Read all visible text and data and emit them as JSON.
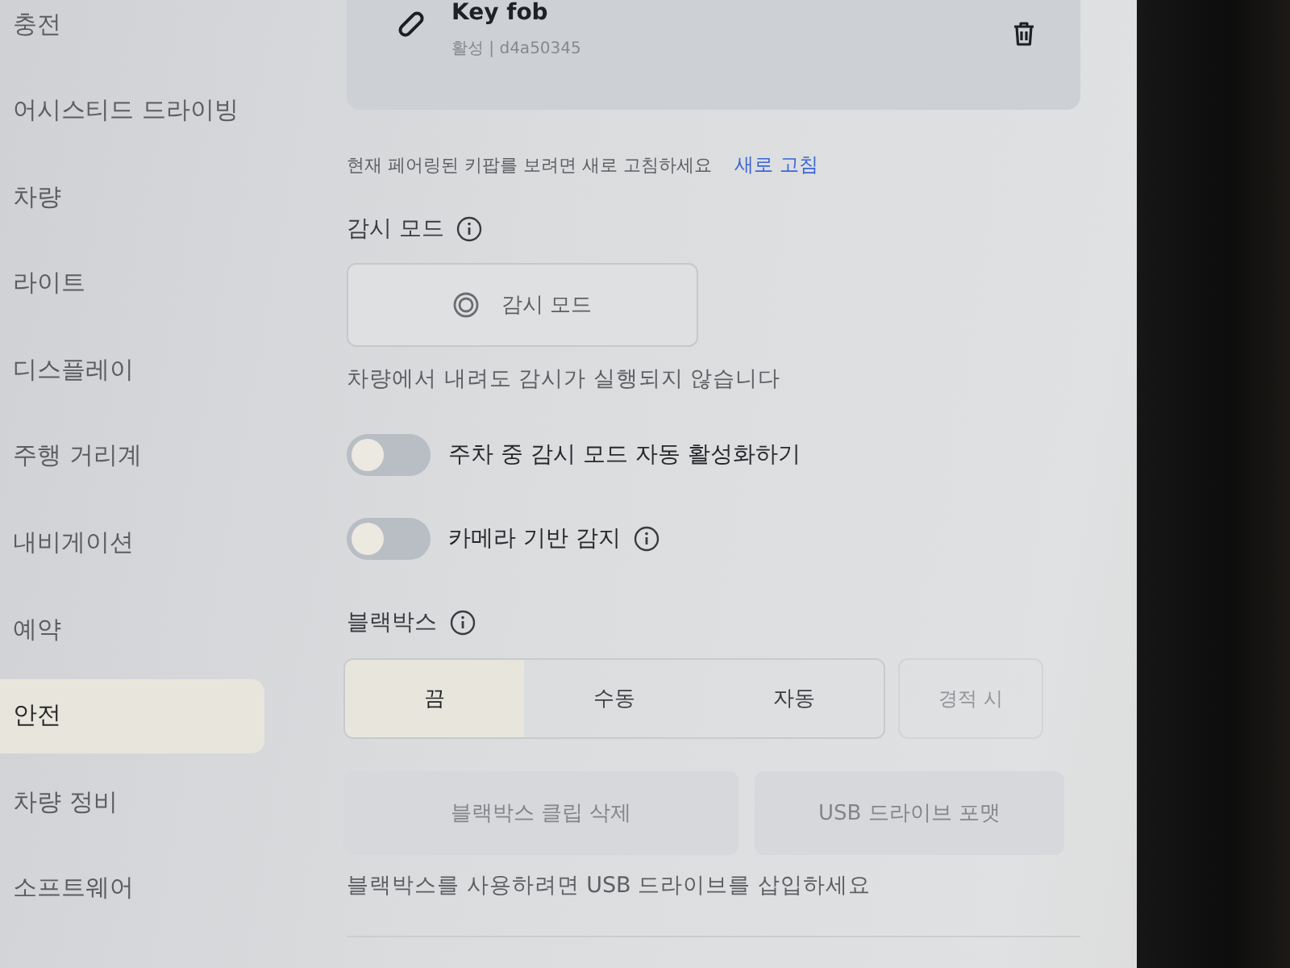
{
  "sidebar": {
    "items": [
      {
        "label": "충전",
        "selected": false
      },
      {
        "label": "어시스티드 드라이빙",
        "selected": false
      },
      {
        "label": "차량",
        "selected": false
      },
      {
        "label": "라이트",
        "selected": false
      },
      {
        "label": "디스플레이",
        "selected": false
      },
      {
        "label": "주행 거리계",
        "selected": false
      },
      {
        "label": "내비게이션",
        "selected": false
      },
      {
        "label": "예약",
        "selected": false
      },
      {
        "label": "안전",
        "selected": true
      },
      {
        "label": "차량 정비",
        "selected": false
      },
      {
        "label": "소프트웨어",
        "selected": false
      }
    ]
  },
  "key_card": {
    "name": "Key fob",
    "status": "활성 | d4a50345"
  },
  "refresh_note": {
    "text": "현재 페어링된 키팝를 보려면 새로 고침하세요",
    "link": "새로 고침"
  },
  "sentry_mode": {
    "title": "감시 모드",
    "button": "감시 모드",
    "note": "차량에서 내려도 감시가 실행되지 않습니다",
    "toggles": [
      {
        "label": "주차 중 감시 모드 자동 활성화하기",
        "on": false,
        "info": false
      },
      {
        "label": "카메라 기반 감지",
        "on": false,
        "info": true
      }
    ]
  },
  "dashcam": {
    "title": "블랙박스",
    "segments": [
      {
        "label": "끔",
        "selected": true
      },
      {
        "label": "수동",
        "selected": false
      },
      {
        "label": "자동",
        "selected": false
      }
    ],
    "extra": {
      "label": "경적 시",
      "disabled": true
    },
    "actions": [
      {
        "label": "블랙박스 클립 삭제",
        "disabled": true
      },
      {
        "label": "USB 드라이브 포맷",
        "disabled": true
      }
    ],
    "note": "블랙박스를 사용하려면 USB 드라이브를 삽입하세요"
  }
}
